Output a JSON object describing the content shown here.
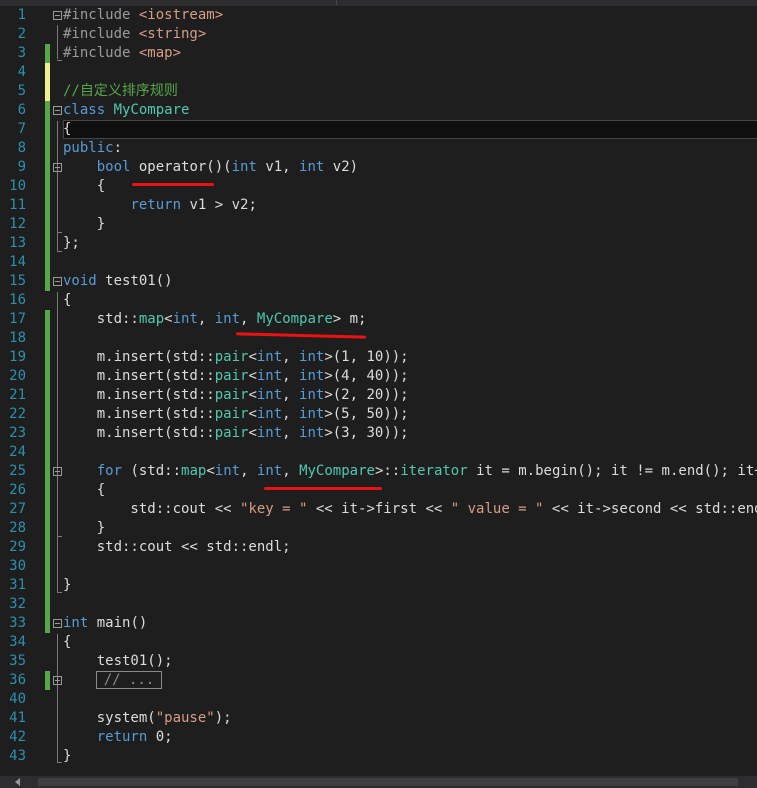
{
  "editor": {
    "lines": [
      {
        "n": "1",
        "segs": [
          [
            "pp",
            "#include "
          ],
          [
            "st",
            "<iostream>"
          ]
        ]
      },
      {
        "n": "2",
        "segs": [
          [
            "pp",
            "#include "
          ],
          [
            "st",
            "<string>"
          ]
        ]
      },
      {
        "n": "3",
        "segs": [
          [
            "pp",
            "#include "
          ],
          [
            "st",
            "<map>"
          ]
        ]
      },
      {
        "n": "4",
        "segs": []
      },
      {
        "n": "5",
        "segs": [
          [
            "cm",
            "//自定义排序规则"
          ]
        ]
      },
      {
        "n": "6",
        "segs": [
          [
            "kw",
            "class "
          ],
          [
            "ty",
            "MyCompare"
          ]
        ]
      },
      {
        "n": "7",
        "segs": [
          [
            "",
            "{"
          ]
        ]
      },
      {
        "n": "8",
        "segs": [
          [
            "kw",
            "public"
          ],
          [
            "",
            ":"
          ]
        ]
      },
      {
        "n": "9",
        "segs": [
          [
            "",
            "    "
          ],
          [
            "kw",
            "bool "
          ],
          [
            "",
            "operator()("
          ],
          [
            "kw",
            "int"
          ],
          [
            "",
            " v1, "
          ],
          [
            "kw",
            "int"
          ],
          [
            "",
            " v2)"
          ]
        ]
      },
      {
        "n": "10",
        "segs": [
          [
            "",
            "    {"
          ]
        ]
      },
      {
        "n": "11",
        "segs": [
          [
            "",
            "        "
          ],
          [
            "kw",
            "return"
          ],
          [
            "",
            " v1 > v2;"
          ]
        ]
      },
      {
        "n": "12",
        "segs": [
          [
            "",
            "    }"
          ]
        ]
      },
      {
        "n": "13",
        "segs": [
          [
            "",
            "};"
          ]
        ]
      },
      {
        "n": "14",
        "segs": []
      },
      {
        "n": "15",
        "segs": [
          [
            "kw",
            "void"
          ],
          [
            "",
            " test01()"
          ]
        ]
      },
      {
        "n": "16",
        "segs": [
          [
            "",
            "{"
          ]
        ]
      },
      {
        "n": "17",
        "segs": [
          [
            "",
            "    std::"
          ],
          [
            "ty",
            "map"
          ],
          [
            "",
            "<"
          ],
          [
            "kw",
            "int"
          ],
          [
            "",
            ", "
          ],
          [
            "kw",
            "int"
          ],
          [
            "",
            ", "
          ],
          [
            "ty",
            "MyCompare"
          ],
          [
            "",
            "> m;"
          ]
        ]
      },
      {
        "n": "18",
        "segs": []
      },
      {
        "n": "19",
        "segs": [
          [
            "",
            "    m.insert(std::"
          ],
          [
            "ty",
            "pair"
          ],
          [
            "",
            "<"
          ],
          [
            "kw",
            "int"
          ],
          [
            "",
            ", "
          ],
          [
            "kw",
            "int"
          ],
          [
            "",
            ">(1, 10));"
          ]
        ]
      },
      {
        "n": "20",
        "segs": [
          [
            "",
            "    m.insert(std::"
          ],
          [
            "ty",
            "pair"
          ],
          [
            "",
            "<"
          ],
          [
            "kw",
            "int"
          ],
          [
            "",
            ", "
          ],
          [
            "kw",
            "int"
          ],
          [
            "",
            ">(4, 40));"
          ]
        ]
      },
      {
        "n": "21",
        "segs": [
          [
            "",
            "    m.insert(std::"
          ],
          [
            "ty",
            "pair"
          ],
          [
            "",
            "<"
          ],
          [
            "kw",
            "int"
          ],
          [
            "",
            ", "
          ],
          [
            "kw",
            "int"
          ],
          [
            "",
            ">(2, 20));"
          ]
        ]
      },
      {
        "n": "22",
        "segs": [
          [
            "",
            "    m.insert(std::"
          ],
          [
            "ty",
            "pair"
          ],
          [
            "",
            "<"
          ],
          [
            "kw",
            "int"
          ],
          [
            "",
            ", "
          ],
          [
            "kw",
            "int"
          ],
          [
            "",
            ">(5, 50));"
          ]
        ]
      },
      {
        "n": "23",
        "segs": [
          [
            "",
            "    m.insert(std::"
          ],
          [
            "ty",
            "pair"
          ],
          [
            "",
            "<"
          ],
          [
            "kw",
            "int"
          ],
          [
            "",
            ", "
          ],
          [
            "kw",
            "int"
          ],
          [
            "",
            ">(3, 30));"
          ]
        ]
      },
      {
        "n": "24",
        "segs": []
      },
      {
        "n": "25",
        "segs": [
          [
            "",
            "    "
          ],
          [
            "kw",
            "for"
          ],
          [
            "",
            " (std::"
          ],
          [
            "ty",
            "map"
          ],
          [
            "",
            "<"
          ],
          [
            "kw",
            "int"
          ],
          [
            "",
            ", "
          ],
          [
            "kw",
            "int"
          ],
          [
            "",
            ", "
          ],
          [
            "ty",
            "MyCompare"
          ],
          [
            "",
            ">::"
          ],
          [
            "ty",
            "iterator"
          ],
          [
            "",
            " it = m.begin(); it != m.end(); it++)"
          ]
        ]
      },
      {
        "n": "26",
        "segs": [
          [
            "",
            "    {"
          ]
        ]
      },
      {
        "n": "27",
        "segs": [
          [
            "",
            "        std::cout << "
          ],
          [
            "st",
            "\"key = \""
          ],
          [
            "",
            " << it->first << "
          ],
          [
            "st",
            "\" value = \""
          ],
          [
            "",
            " << it->second << std::endl;"
          ]
        ]
      },
      {
        "n": "28",
        "segs": [
          [
            "",
            "    }"
          ]
        ]
      },
      {
        "n": "29",
        "segs": [
          [
            "",
            "    std::cout << std::endl;"
          ]
        ]
      },
      {
        "n": "30",
        "segs": []
      },
      {
        "n": "31",
        "segs": [
          [
            "",
            "}"
          ]
        ]
      },
      {
        "n": "32",
        "segs": []
      },
      {
        "n": "33",
        "segs": [
          [
            "kw",
            "int"
          ],
          [
            "",
            " main()"
          ]
        ]
      },
      {
        "n": "34",
        "segs": [
          [
            "",
            "{"
          ]
        ]
      },
      {
        "n": "35",
        "segs": [
          [
            "",
            "    test01();"
          ]
        ]
      },
      {
        "n": "36",
        "segs": []
      },
      {
        "n": "40",
        "segs": []
      },
      {
        "n": "41",
        "segs": [
          [
            "",
            "    system("
          ],
          [
            "st",
            "\"pause\""
          ],
          [
            "",
            ");"
          ]
        ]
      },
      {
        "n": "42",
        "segs": [
          [
            "",
            "    "
          ],
          [
            "kw",
            "return"
          ],
          [
            "",
            " 0;"
          ]
        ]
      },
      {
        "n": "43",
        "segs": [
          [
            "",
            "}"
          ]
        ]
      }
    ],
    "collapsed_region_label": "// ...",
    "colors": {
      "background": "#1e1e1e",
      "line_number": "#2b91af",
      "keyword": "#569cd6",
      "type": "#4ec9b0",
      "string": "#d69d85",
      "comment": "#57a64a",
      "preprocessor": "#9b9b9b",
      "change_saved": "#57a64a",
      "change_unsaved": "#efef90",
      "annotation": "#ee1111"
    }
  }
}
